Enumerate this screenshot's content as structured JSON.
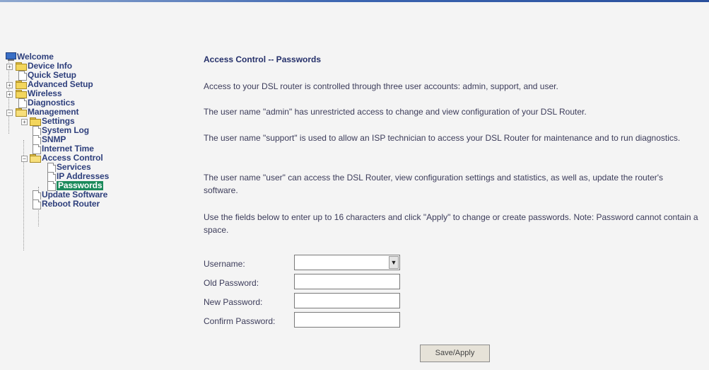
{
  "nav": {
    "root": "Welcome",
    "device_info": "Device Info",
    "quick_setup": "Quick Setup",
    "advanced_setup": "Advanced Setup",
    "wireless": "Wireless",
    "diagnostics": "Diagnostics",
    "management": "Management",
    "settings": "Settings",
    "system_log": "System Log",
    "snmp": "SNMP",
    "internet_time": "Internet Time",
    "access_control": "Access Control",
    "services": "Services",
    "ip_addresses": "IP Addresses",
    "passwords": "Passwords",
    "update_software": "Update Software",
    "reboot_router": "Reboot Router"
  },
  "main": {
    "title": "Access Control -- Passwords",
    "p1": "Access to your DSL router is controlled through three user accounts: admin, support, and user.",
    "p2": "The user name \"admin\" has unrestricted access to change and view configuration of your DSL Router.",
    "p3": "The user name \"support\" is used to allow an ISP technician to access your DSL Router for maintenance and to run diagnostics.",
    "p4": "The user name \"user\" can access the DSL Router, view configuration settings and statistics, as well as, update the router's software.",
    "p5": "Use the fields below to enter up to 16 characters and click \"Apply\" to change or create passwords. Note: Password cannot contain a space.",
    "username_label": "Username:",
    "username_value": "",
    "old_password_label": "Old Password:",
    "new_password_label": "New Password:",
    "confirm_password_label": "Confirm Password:",
    "apply_label": "Save/Apply"
  },
  "colors": {
    "selected_bg": "#1b8a5b",
    "nav_text": "#2e3f7c",
    "title_text": "#25306a"
  }
}
